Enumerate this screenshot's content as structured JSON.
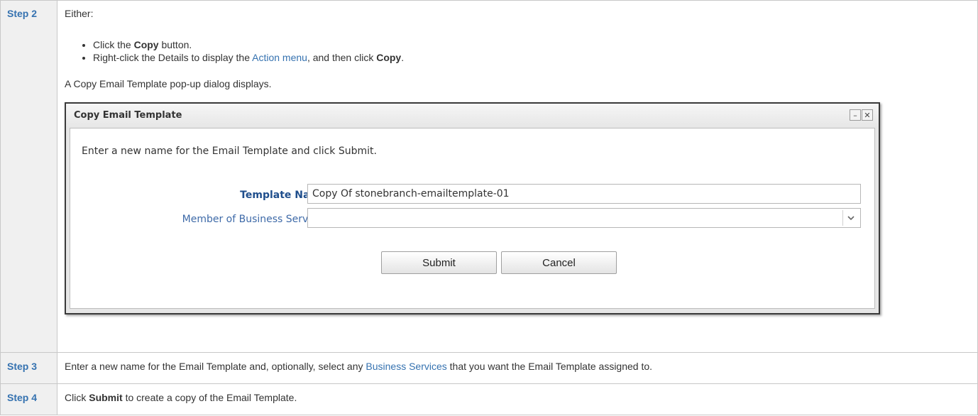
{
  "steps": [
    {
      "label": "Step 2",
      "intro": "Either:",
      "bullets": [
        {
          "pre": "Click the ",
          "bold": "Copy",
          "post": " button."
        },
        {
          "pre": "Right-click the Details to display the ",
          "link": "Action menu",
          "mid": ", and then click ",
          "bold": "Copy",
          "post": "."
        }
      ],
      "after": "A Copy Email Template pop-up dialog displays."
    },
    {
      "label": "Step 3",
      "pre": "Enter a new name for the Email Template and, optionally, select any ",
      "link": "Business Services",
      "post": " that you want the Email Template assigned to."
    },
    {
      "label": "Step 4",
      "pre": "Click ",
      "bold": "Submit",
      "post": " to create a copy of the Email Template."
    }
  ],
  "dialog": {
    "title": "Copy Email Template",
    "minimize_glyph": "–",
    "close_glyph": "✕",
    "instruction": "Enter a new name for the Email Template and click Submit.",
    "template_name_label": "Template Name :",
    "template_name_value": "Copy Of stonebranch-emailtemplate-01",
    "member_label": "Member of Business Services :",
    "member_value": "",
    "submit_label": "Submit",
    "cancel_label": "Cancel"
  },
  "icons": {
    "minimize": "minimize-icon",
    "close": "close-icon",
    "dropdown": "chevron-down-icon"
  },
  "colors": {
    "step_label": "#3572b0",
    "link": "#3572b0",
    "step_column_bg": "#f0f0f0"
  }
}
